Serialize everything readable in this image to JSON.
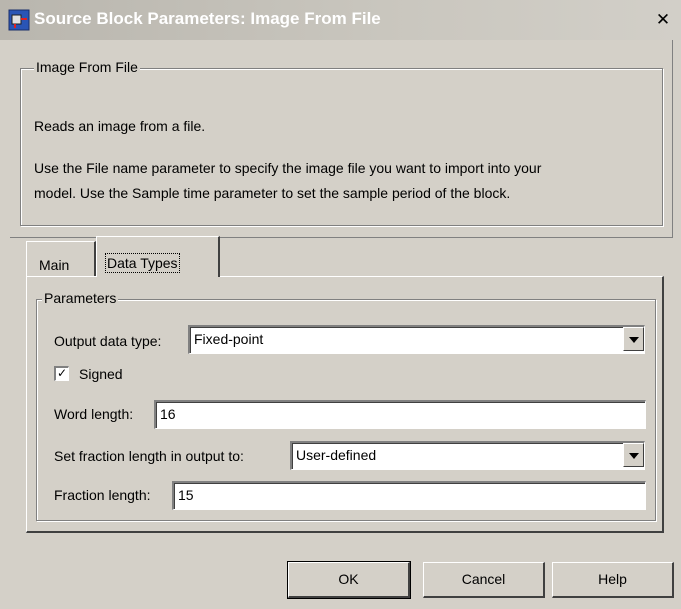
{
  "window": {
    "title": "Source Block Parameters: Image From File",
    "close_glyph": "✕"
  },
  "description": {
    "group_title": "Image From File",
    "line1": "Reads an image from a file.",
    "line2": "Use the File name parameter to specify the image file you want to import into your",
    "line3": "model. Use the Sample time parameter to set the sample period of the block."
  },
  "tabs": [
    {
      "label": "Main",
      "active": false
    },
    {
      "label": "Data Types",
      "active": true
    }
  ],
  "parameters": {
    "group_title": "Parameters",
    "output_data_type_label": "Output data type:",
    "output_data_type_value": "Fixed-point",
    "signed_label": "Signed",
    "signed_checked": true,
    "check_glyph": "✓",
    "word_length_label": "Word length:",
    "word_length_value": "16",
    "fraction_mode_label": "Set fraction length in output to:",
    "fraction_mode_value": "User-defined",
    "fraction_length_label": "Fraction length:",
    "fraction_length_value": "15"
  },
  "buttons": {
    "ok": "OK",
    "cancel": "Cancel",
    "help": "Help"
  },
  "icons": {
    "title_icon": "simulink-block-icon",
    "dropdown_icon": "chevron-down-icon"
  }
}
